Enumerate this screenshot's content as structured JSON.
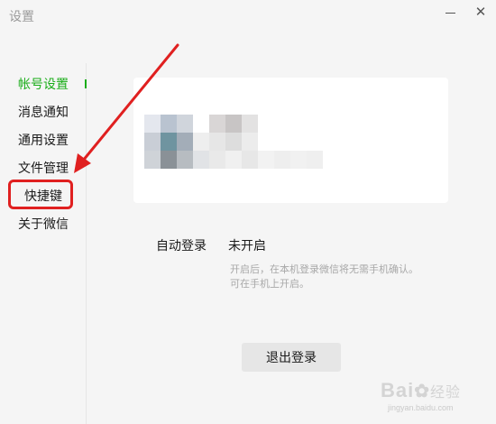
{
  "window": {
    "title": "设置",
    "minimize_icon": "minimize-icon",
    "close_icon": "close-icon",
    "close_glyph": "✕"
  },
  "sidebar": {
    "items": [
      {
        "label": "帐号设置",
        "active": true
      },
      {
        "label": "消息通知",
        "active": false
      },
      {
        "label": "通用设置",
        "active": false
      },
      {
        "label": "文件管理",
        "active": false
      },
      {
        "label": "快捷键",
        "active": false,
        "highlighted": true
      },
      {
        "label": "关于微信",
        "active": false
      }
    ]
  },
  "account": {
    "auto_login_label": "自动登录",
    "auto_login_value": "未开启",
    "hint_line1": "开启后，在本机登录微信将无需手机确认。",
    "hint_line2": "可在手机上开启。",
    "logout_label": "退出登录"
  },
  "watermark": {
    "brand": "Bai",
    "brand_tail": "经验",
    "url": "jingyan.baidu.com"
  },
  "colors": {
    "accent": "#1aad19",
    "annotation": "#e02020",
    "background": "#f5f5f5",
    "card": "#ffffff",
    "button": "#e6e6e6"
  }
}
